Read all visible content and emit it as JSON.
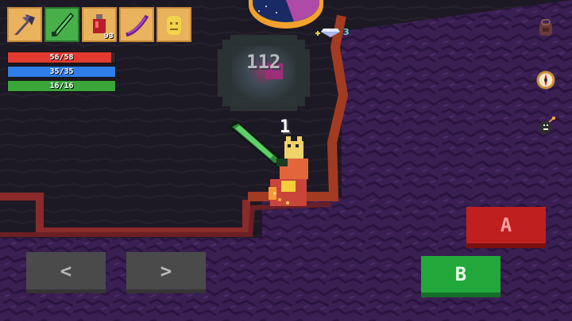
{
  "hud": {
    "hotbar": [
      {
        "name": "battle-axe",
        "count": ""
      },
      {
        "name": "green-greatsword",
        "count": "",
        "selected": true
      },
      {
        "name": "health-potion",
        "count": "93"
      },
      {
        "name": "purple-scythe",
        "count": ""
      },
      {
        "name": "golden-idol",
        "count": ""
      }
    ],
    "health": {
      "text": "56/58",
      "fraction": 0.966,
      "color": "#e23a2f"
    },
    "mana": {
      "text": "35/35",
      "fraction": 1.0,
      "color": "#2f7ee8"
    },
    "stamina": {
      "text": "16/16",
      "fraction": 1.0,
      "color": "#3aa63a"
    },
    "gems": "3"
  },
  "combat": {
    "damage_numbers": [
      "112",
      "1"
    ]
  },
  "side_icons": [
    "backpack-icon",
    "compass-icon",
    "bomb-icon"
  ],
  "controls": {
    "left_label": "<",
    "right_label": ">",
    "a_label": "A",
    "b_label": "B"
  }
}
